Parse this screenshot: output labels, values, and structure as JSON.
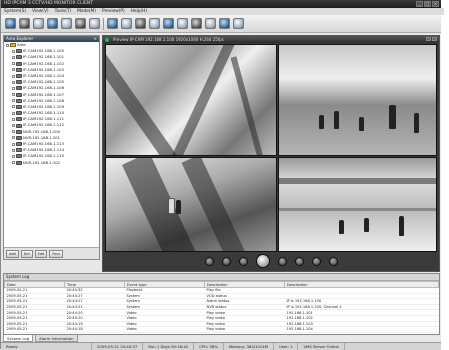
{
  "window": {
    "title": "HD IPCAM 3 CCTV/HD MONITOR CLIENT"
  },
  "menu": [
    "System(S)",
    "View(V)",
    "Tools(T)",
    "Mode(M)",
    "Preview(P)",
    "Help(H)"
  ],
  "tree": {
    "title": "Area Explorer",
    "root": "Area",
    "items": [
      "IP-CAM192.168.1.100",
      "IP-CAM192.168.1.101",
      "IP-CAM192.168.1.102",
      "IP-CAM192.168.1.103",
      "IP-CAM192.168.1.104",
      "IP-CAM192.168.1.105",
      "IP-CAM192.168.1.106",
      "IP-CAM192.168.1.107",
      "IP-CAM192.168.1.108",
      "IP-CAM192.168.1.109",
      "IP-CAM192.168.1.110",
      "IP-CAM192.168.1.111",
      "IP-CAM192.168.1.112",
      "NVR-192.168.1.200",
      "NVR-192.168.1.201",
      "IP-CAM192.168.1.113",
      "IP-CAM192.168.1.114",
      "IP-CAM192.168.1.115",
      "NVR-192.168.1.202"
    ],
    "buttons": [
      "Add",
      "Del",
      "Edit",
      "Find"
    ]
  },
  "video": {
    "title": "Preview  IP-CAM 192.168.1.100  1920x1080 H.264 25fps"
  },
  "log": {
    "title": "System Log",
    "columns": [
      "Date",
      "Time",
      "Event type",
      "Description",
      "Description"
    ],
    "rows": [
      [
        "2009-05-21",
        "20:44:32",
        "Playback",
        "Play file",
        ""
      ],
      [
        "2009-05-21",
        "20:44:27",
        "System",
        "VOD status",
        ""
      ],
      [
        "2009-05-21",
        "20:44:27",
        "System",
        "Alarm status",
        "IP is 192.168.1.100"
      ],
      [
        "2009-05-21",
        "20:44:21",
        "System",
        "NVR status",
        "IP is 192.168.1.200, Channel 1"
      ],
      [
        "2009-05-21",
        "20:44:20",
        "Video",
        "Play video",
        "192.168.1.101"
      ],
      [
        "2009-05-21",
        "20:44:20",
        "Video",
        "Play video",
        "192.168.1.102"
      ],
      [
        "2009-05-21",
        "20:44:19",
        "Video",
        "Play video",
        "192.168.1.103"
      ],
      [
        "2009-05-21",
        "20:44:18",
        "Video",
        "Play video",
        "192.168.1.104"
      ]
    ]
  },
  "log_tabs": [
    "System Log",
    "Alarm Information"
  ],
  "status": {
    "ready": "Ready",
    "time": "2009-05-21 20:44:37",
    "run": "Run 1 Days 00:18:42",
    "cpu": "CPU: 38%",
    "memory": "Memory: 384/1024M",
    "user": "User: 1",
    "server": "VMS Server Online"
  }
}
